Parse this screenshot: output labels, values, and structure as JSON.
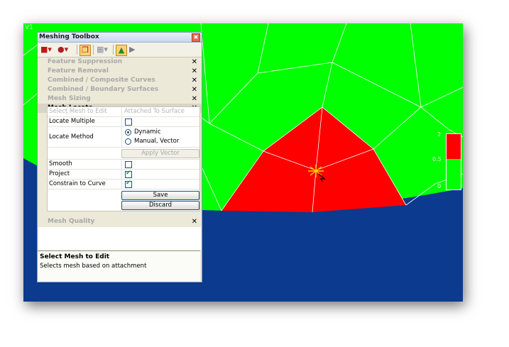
{
  "viewport": {
    "label": "V1",
    "colors": {
      "background": "#0b3a8f",
      "surface": "#00ff00",
      "highlight": "#ff0000",
      "mesh_lines": "#ffffff"
    },
    "legend": {
      "ticks": [
        "2",
        "0.5",
        "0"
      ],
      "colors": [
        "#ff0000",
        "#00ff00"
      ]
    }
  },
  "toolbox": {
    "title": "Meshing Toolbox",
    "close_glyph": "✖",
    "toolbar": {
      "icons": [
        "mesh-create-icon",
        "mesh-edit-icon",
        "copy-icon",
        "grid-icon",
        "mesh-locate-icon",
        "pointer-icon"
      ]
    },
    "sections": [
      {
        "label": "Feature Suppression",
        "close": "✕"
      },
      {
        "label": "Feature Removal",
        "close": "✕"
      },
      {
        "label": "Combined / Composite Curves",
        "close": "✕"
      },
      {
        "label": "Combined / Boundary Surfaces",
        "close": "✕"
      },
      {
        "label": "Mesh Sizing",
        "close": "✕"
      },
      {
        "label": "Mesh Locate",
        "close": "✕"
      }
    ],
    "mesh_locate": {
      "select_label": "Select Mesh to Edit",
      "select_value": "Attached To Surface",
      "locate_multiple": "Locate Multiple",
      "locate_method": "Locate Method",
      "method_dynamic": "Dynamic",
      "method_manual": "Manual, Vector",
      "apply_vector": "Apply Vector",
      "smooth": "Smooth",
      "project": "Project",
      "constrain": "Constrain to Curve",
      "save": "Save",
      "discard": "Discard"
    },
    "mesh_quality": {
      "label": "Mesh Quality",
      "close": "✕"
    },
    "status": {
      "heading": "Select Mesh to Edit",
      "description": "Selects mesh based on attachment"
    }
  }
}
